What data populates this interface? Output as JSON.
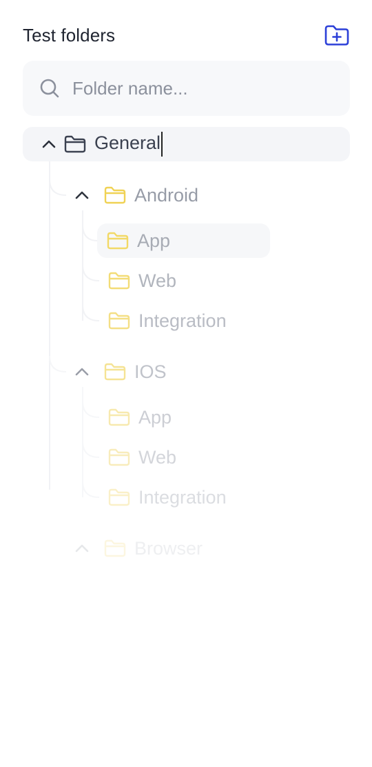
{
  "header": {
    "title": "Test folders",
    "new_folder_icon": "folder-plus-icon"
  },
  "search": {
    "placeholder": "Folder name...",
    "value": ""
  },
  "colors": {
    "accent": "#2b3fd8",
    "folder_yellow": "#f0d254",
    "text_dark": "#1f2430",
    "muted": "#9aa0ab"
  },
  "tree": {
    "root": {
      "label": "General",
      "expanded": true
    },
    "groups": [
      {
        "label": "Android",
        "expanded": true,
        "children": [
          "App",
          "Web",
          "Integration"
        ]
      },
      {
        "label": "IOS",
        "expanded": true,
        "children": [
          "App",
          "Web",
          "Integration"
        ]
      },
      {
        "label": "Browser",
        "expanded": true,
        "children": []
      }
    ]
  }
}
